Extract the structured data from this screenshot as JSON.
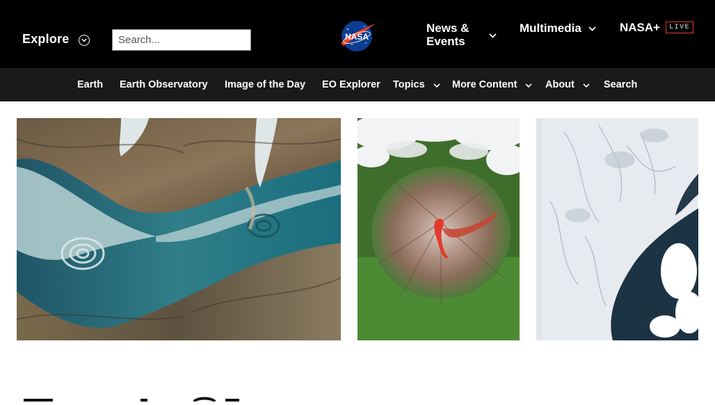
{
  "header": {
    "explore_label": "Explore",
    "search_placeholder": "Search...",
    "logo_text": "NASA",
    "nav": [
      {
        "label": "News & Events"
      },
      {
        "label": "Multimedia"
      },
      {
        "label": "NASA+"
      }
    ],
    "live_badge": "LIVE"
  },
  "subnav": {
    "items": [
      {
        "label": "Earth"
      },
      {
        "label": "Earth Observatory"
      },
      {
        "label": "Image of the Day"
      },
      {
        "label": "EO Explorer"
      },
      {
        "label": "Topics"
      },
      {
        "label": "More Content"
      },
      {
        "label": "About"
      },
      {
        "label": "Search"
      }
    ]
  },
  "cards": [
    {
      "subject": "arctic fjord with swirling sea ice"
    },
    {
      "subject": "volcano summit with lava flow"
    },
    {
      "subject": "snow-covered coastline"
    }
  ],
  "colors": {
    "topbar": "#000000",
    "subnav": "#1a1a1a",
    "live_border": "#e03c31",
    "nasa_blue": "#0b3d91",
    "nasa_red": "#fc3d21"
  }
}
